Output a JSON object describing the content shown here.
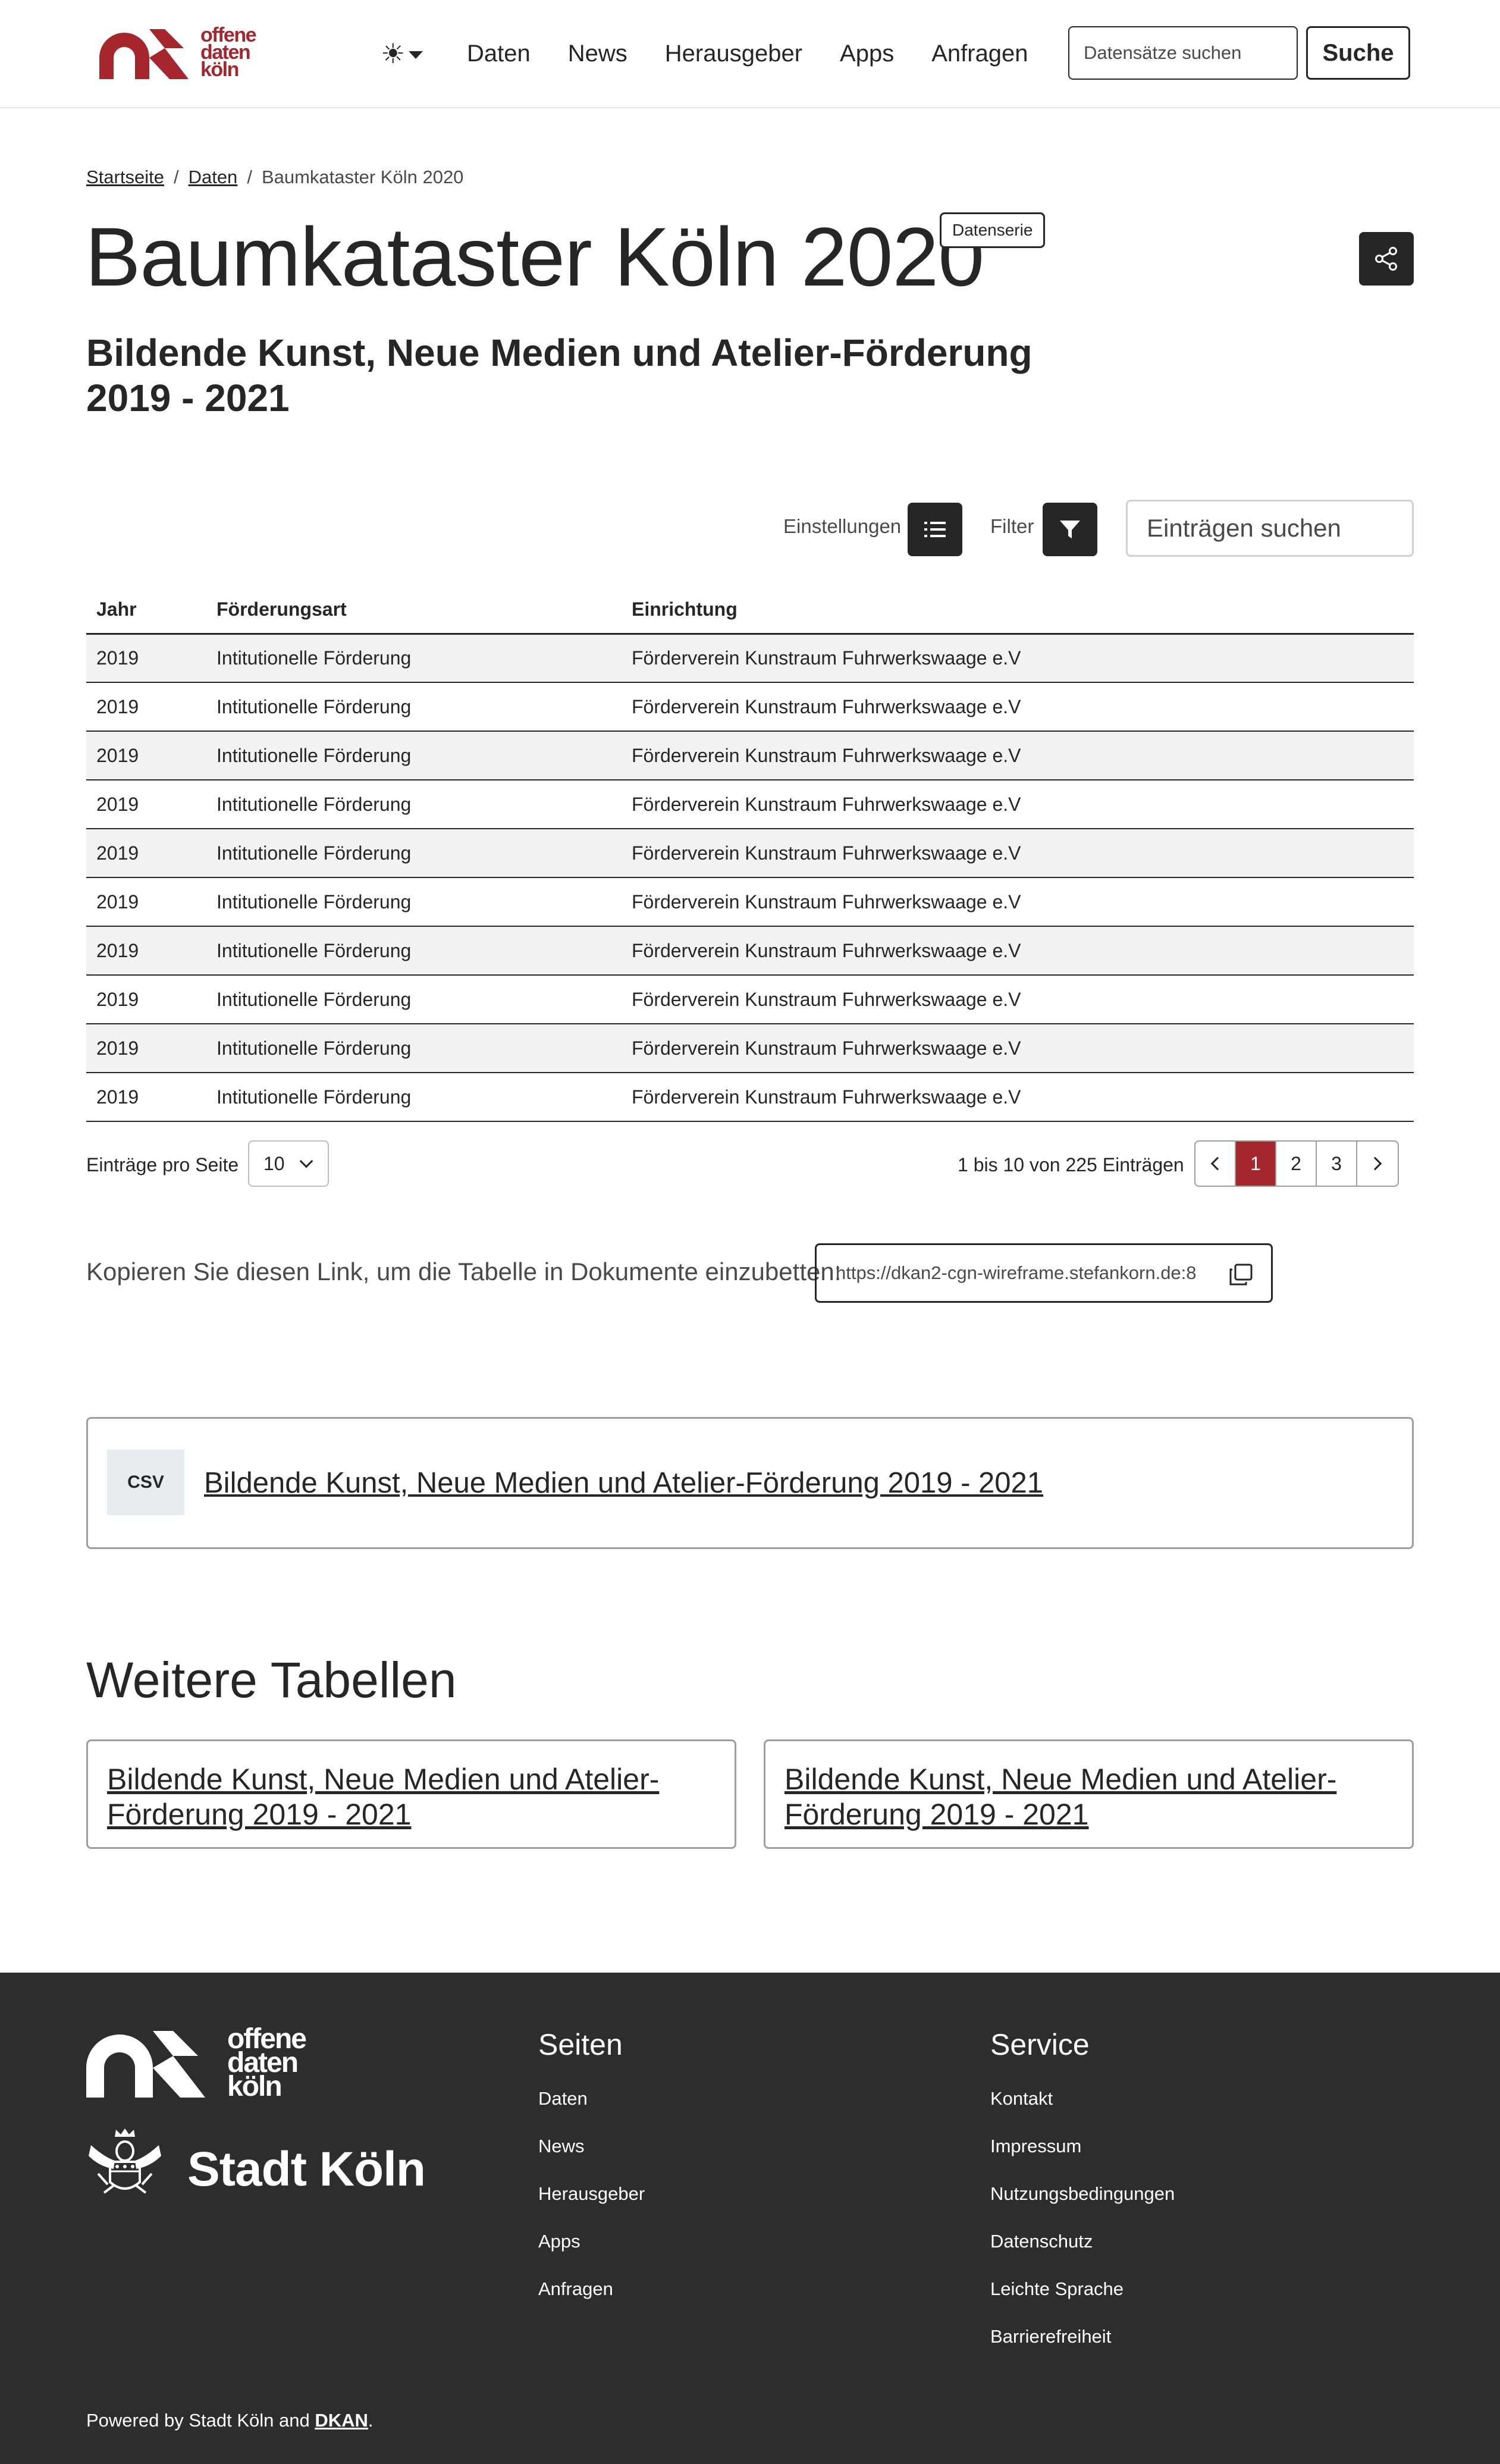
{
  "header": {
    "logo_text": [
      "offene",
      "daten",
      "köln"
    ],
    "theme_icon": "sun-icon",
    "nav": [
      "Daten",
      "News",
      "Herausgeber",
      "Apps",
      "Anfragen"
    ],
    "search_placeholder": "Datensätze suchen",
    "search_button": "Suche"
  },
  "breadcrumb": {
    "items": [
      "Startseite",
      "Daten"
    ],
    "current": "Baumkataster Köln 2020",
    "separator": "/"
  },
  "page": {
    "title": "Baumkataster Köln 2020",
    "badge": "Datenserie",
    "subtitle": "Bildende Kunst, Neue Medien und Atelier-Förderung 2019 - 2021"
  },
  "controls": {
    "settings_label": "Einstellungen",
    "filter_label": "Filter",
    "search_placeholder": "Einträgen suchen"
  },
  "table": {
    "headers": [
      "Jahr",
      "Förderungsart",
      "Einrichtung"
    ],
    "rows": [
      [
        "2019",
        "Intitutionelle Förderung",
        "Förderverein Kunstraum Fuhrwerkswaage e.V"
      ],
      [
        "2019",
        "Intitutionelle Förderung",
        "Förderverein Kunstraum Fuhrwerkswaage e.V"
      ],
      [
        "2019",
        "Intitutionelle Förderung",
        "Förderverein Kunstraum Fuhrwerkswaage e.V"
      ],
      [
        "2019",
        "Intitutionelle Förderung",
        "Förderverein Kunstraum Fuhrwerkswaage e.V"
      ],
      [
        "2019",
        "Intitutionelle Förderung",
        "Förderverein Kunstraum Fuhrwerkswaage e.V"
      ],
      [
        "2019",
        "Intitutionelle Förderung",
        "Förderverein Kunstraum Fuhrwerkswaage e.V"
      ],
      [
        "2019",
        "Intitutionelle Förderung",
        "Förderverein Kunstraum Fuhrwerkswaage e.V"
      ],
      [
        "2019",
        "Intitutionelle Förderung",
        "Förderverein Kunstraum Fuhrwerkswaage e.V"
      ],
      [
        "2019",
        "Intitutionelle Förderung",
        "Förderverein Kunstraum Fuhrwerkswaage e.V"
      ],
      [
        "2019",
        "Intitutionelle Förderung",
        "Förderverein Kunstraum Fuhrwerkswaage e.V"
      ]
    ]
  },
  "pagination": {
    "per_page_label": "Einträge pro Seite",
    "per_page_value": "10",
    "range_text": "1 bis 10 von 225 Einträgen",
    "pages": [
      "1",
      "2",
      "3"
    ],
    "active_page": "1"
  },
  "embed": {
    "label": "Kopieren Sie diesen Link, um die Tabelle in Dokumente einzubetten:",
    "url": "https://dkan2-cgn-wireframe.stefankorn.de:8"
  },
  "resource": {
    "format": "CSV",
    "title": "Bildende Kunst, Neue Medien und Atelier-Förderung 2019 - 2021"
  },
  "more_tables": {
    "title": "Weitere Tabellen",
    "items": [
      "Bildende Kunst, Neue Medien und Atelier-Förderung 2019 - 2021",
      "Bildende Kunst, Neue Medien und Atelier-Förderung 2019 - 2021"
    ]
  },
  "footer": {
    "logo_text": [
      "offene",
      "daten",
      "köln"
    ],
    "city_name": "Stadt Köln",
    "columns": [
      {
        "title": "Seiten",
        "links": [
          "Daten",
          "News",
          "Herausgeber",
          "Apps",
          "Anfragen"
        ]
      },
      {
        "title": "Service",
        "links": [
          "Kontakt",
          "Impressum",
          "Nutzungsbedingungen",
          "Datenschutz",
          "Leichte Sprache",
          "Barrierefreiheit"
        ]
      }
    ],
    "powered_prefix": "Powered by Stadt Köln and ",
    "powered_link": "DKAN",
    "powered_suffix": "."
  },
  "colors": {
    "brand": "#a6262e",
    "dark": "#262626",
    "footer_bg": "#2d2d2d",
    "row_stripe": "#f2f2f2"
  }
}
